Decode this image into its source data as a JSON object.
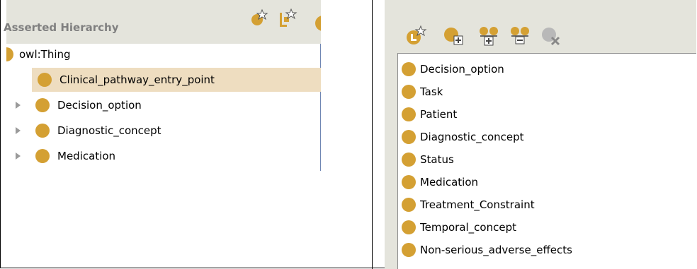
{
  "left_panel": {
    "title": "Asserted Hierarchy",
    "root": "owl:Thing",
    "items": [
      {
        "label": "Clinical_pathway_entry_point",
        "selected": true,
        "expandable": false
      },
      {
        "label": "Decision_option",
        "selected": false,
        "expandable": true
      },
      {
        "label": "Diagnostic_concept",
        "selected": false,
        "expandable": true
      },
      {
        "label": "Medication",
        "selected": false,
        "expandable": true
      }
    ],
    "header_icons": [
      "add-subclass-icon",
      "add-sibling-icon",
      "class-icon"
    ]
  },
  "right_panel": {
    "toolbar_icons": [
      "create-class-icon",
      "add-class-icon",
      "add-subclass-icon",
      "remove-class-icon",
      "delete-class-icon"
    ],
    "items": [
      "Decision_option",
      "Task",
      "Patient",
      "Diagnostic_concept",
      "Status",
      "Medication",
      "Treatment_Constraint",
      "Temporal_concept",
      "Non-serious_adverse_effects"
    ]
  },
  "colors": {
    "class_ball": "#d4a033",
    "header_bg": "#e4e4dc",
    "selection_bg": "#eeddc0",
    "title_gray": "#808080"
  }
}
